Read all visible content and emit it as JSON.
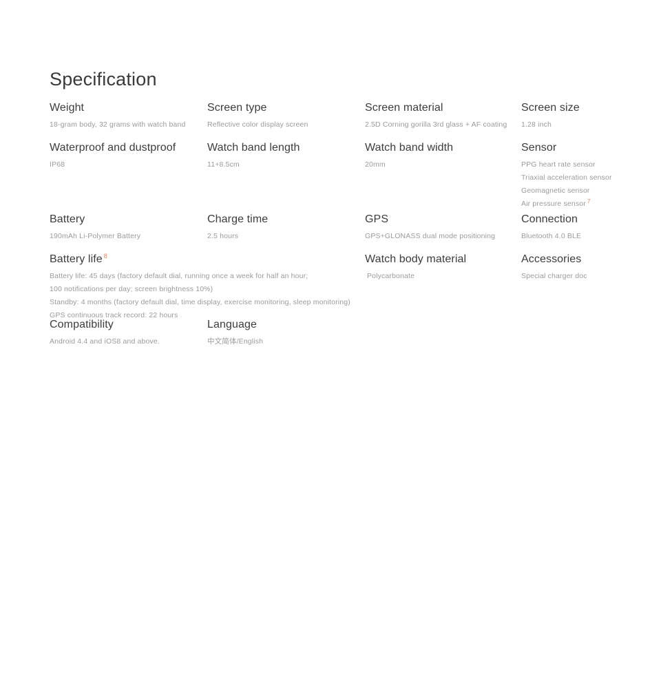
{
  "page": {
    "title": "Specification"
  },
  "specs": {
    "row1": [
      {
        "label": "Weight",
        "value": "18-gram body, 32 grams with watch band"
      },
      {
        "label": "Screen type",
        "value": "Reflective color display screen"
      },
      {
        "label": "Screen material",
        "value": "2.5D Corning gorilla 3rd glass + AF coating"
      },
      {
        "label": "Screen size",
        "value": "1.28 inch"
      }
    ],
    "row2": [
      {
        "label": "Waterproof and dustproof",
        "value": "IP68"
      },
      {
        "label": "Watch band length",
        "value": "11+8.5cm"
      },
      {
        "label": "Watch band width",
        "value": "20mm"
      },
      {
        "label": "Sensor",
        "values": [
          "PPG heart rate sensor",
          "Triaxial acceleration sensor",
          "Geomagnetic sensor",
          "Air pressure sensor"
        ],
        "footnote": "7"
      }
    ],
    "row3": [
      {
        "label": "Battery",
        "value": "190mAh Li-Polymer Battery"
      },
      {
        "label": "Charge time",
        "value": "2.5 hours"
      },
      {
        "label": "GPS",
        "value": "GPS+GLONASS dual mode positioning"
      },
      {
        "label": "Connection",
        "value": "Bluetooth 4.0 BLE"
      }
    ],
    "row4": [
      {
        "label": "Battery life",
        "footnote": "8",
        "values": [
          "Battery life: 45 days (factory default dial, running once a week for half an hour;",
          "100 notifications per day; screen brightness 10%)",
          "Standby: 4 months (factory default dial, time display, exercise monitoring, sleep monitoring)",
          "GPS continuous track record: 22 hours"
        ]
      },
      {
        "label": "Watch body material",
        "value": "Polycarbonate"
      },
      {
        "label": "Accessories",
        "value": "Special charger doc"
      }
    ],
    "row5": [
      {
        "label": "Compatibility",
        "value": "Android 4.4 and iOS8 and above."
      },
      {
        "label": "Language",
        "value": "中文简体/English"
      }
    ]
  },
  "colors": {
    "heading": "#3c3c3c",
    "body": "#9b9b9b",
    "footnote": "#e8845a",
    "background": "#ffffff"
  }
}
